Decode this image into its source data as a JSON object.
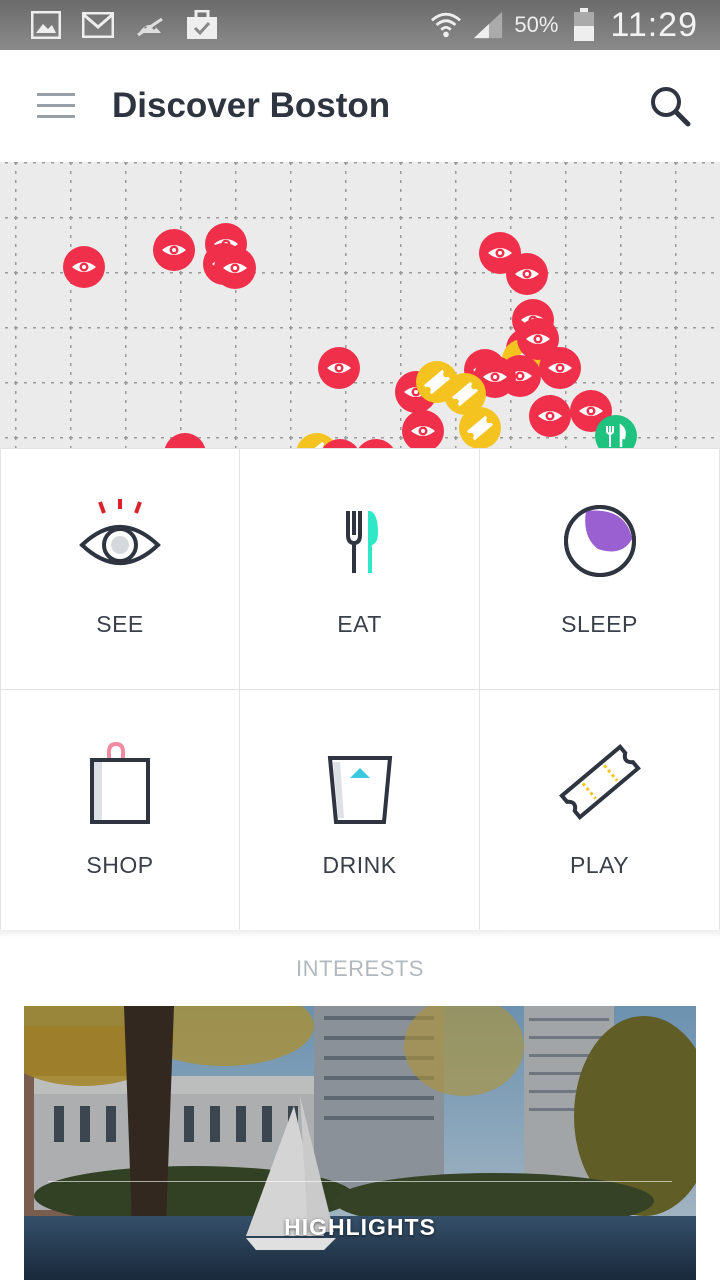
{
  "status_bar": {
    "icons": [
      "gallery-icon",
      "gmail-icon",
      "android-debug-icon",
      "briefcase-check-icon",
      "wifi-icon",
      "signal-icon",
      "battery-icon"
    ],
    "battery": "50%",
    "time": "11:29"
  },
  "appbar": {
    "title": "Discover Boston",
    "menu_icon": "hamburger-menu-icon",
    "search_icon": "search-icon"
  },
  "map": {
    "pin_types": {
      "see": {
        "color": "#f0304a",
        "icon": "eye-icon"
      },
      "play": {
        "color": "#f5c320",
        "icon": "ticket-icon"
      },
      "eat": {
        "color": "#1fc27e",
        "icon": "fork-knife-icon"
      }
    }
  },
  "categories": [
    {
      "label": "SEE",
      "icon": "eye-icon"
    },
    {
      "label": "EAT",
      "icon": "fork-knife-icon"
    },
    {
      "label": "SLEEP",
      "icon": "moon-icon"
    },
    {
      "label": "SHOP",
      "icon": "shopping-bag-icon"
    },
    {
      "label": "DRINK",
      "icon": "glass-icon"
    },
    {
      "label": "PLAY",
      "icon": "ticket-icon"
    }
  ],
  "colors": {
    "dark": "#2e3440",
    "see_accent": "#d8232a",
    "eat_accent": "#2ee8c8",
    "sleep_accent": "#9a5fd1",
    "shop_accent": "#f08ba0",
    "drink_accent": "#3fc7e0",
    "play_accent": "#f5c320"
  },
  "interests": {
    "title": "INTERESTS",
    "cards": [
      {
        "label": "HIGHLIGHTS"
      }
    ]
  }
}
